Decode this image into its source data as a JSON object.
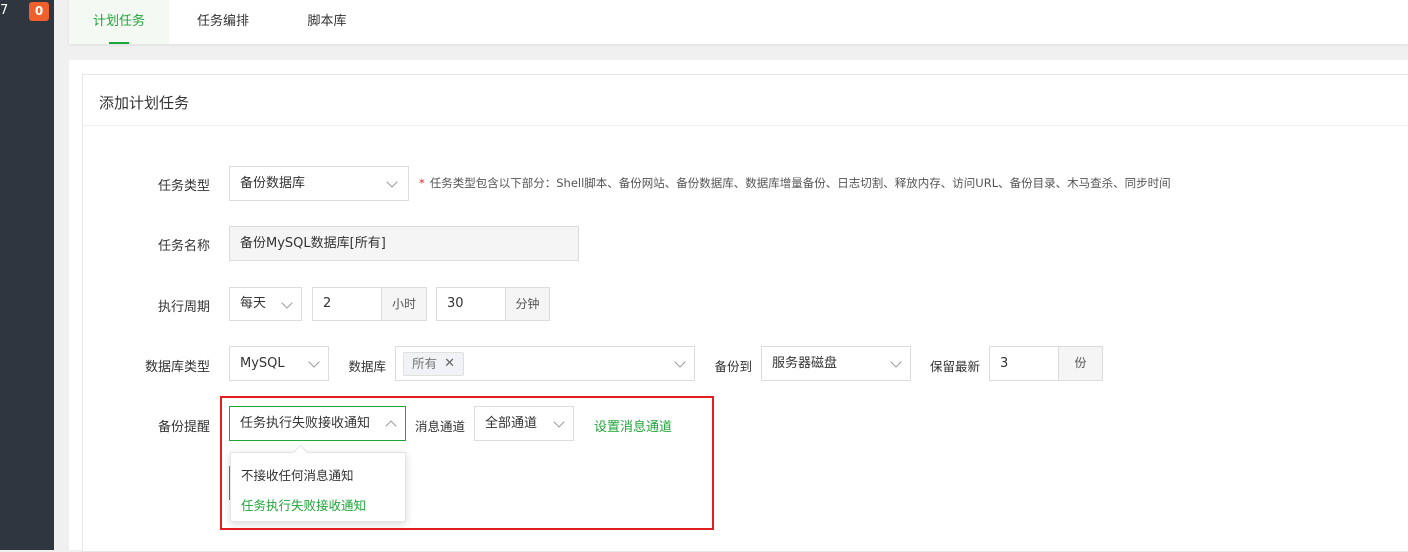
{
  "sidebar": {
    "count": "7",
    "badge": "0"
  },
  "tabs": [
    {
      "label": "计划任务",
      "active": true
    },
    {
      "label": "任务编排",
      "active": false
    },
    {
      "label": "脚本库",
      "active": false
    }
  ],
  "card": {
    "title": "添加计划任务"
  },
  "form": {
    "task_type": {
      "label": "任务类型",
      "value": "备份数据库",
      "tip": "任务类型包含以下部分：Shell脚本、备份网站、备份数据库、数据库增量备份、日志切割、释放内存、访问URL、备份目录、木马查杀、同步时间"
    },
    "task_name": {
      "label": "任务名称",
      "value": "备份MySQL数据库[所有]"
    },
    "period": {
      "label": "执行周期",
      "freq": "每天",
      "hour": "2",
      "hour_unit": "小时",
      "minute": "30",
      "minute_unit": "分钟"
    },
    "database": {
      "type_label": "数据库类型",
      "type_value": "MySQL",
      "db_label": "数据库",
      "db_chip": "所有",
      "backup_to_label": "备份到",
      "backup_to_value": "服务器磁盘",
      "keep_label": "保留最新",
      "keep_value": "3",
      "keep_unit": "份"
    },
    "notify": {
      "label": "备份提醒",
      "value": "任务执行失败接收通知",
      "channel_label": "消息通道",
      "channel_value": "全部通道",
      "setup_link": "设置消息通道",
      "options": [
        "不接收任何消息通知",
        "任务执行失败接收通知"
      ],
      "selected_index": 1
    }
  },
  "colors": {
    "accent": "#20a53a",
    "badge": "#f0602c",
    "highlight_box": "#e02020",
    "sidebar": "#30363f"
  }
}
